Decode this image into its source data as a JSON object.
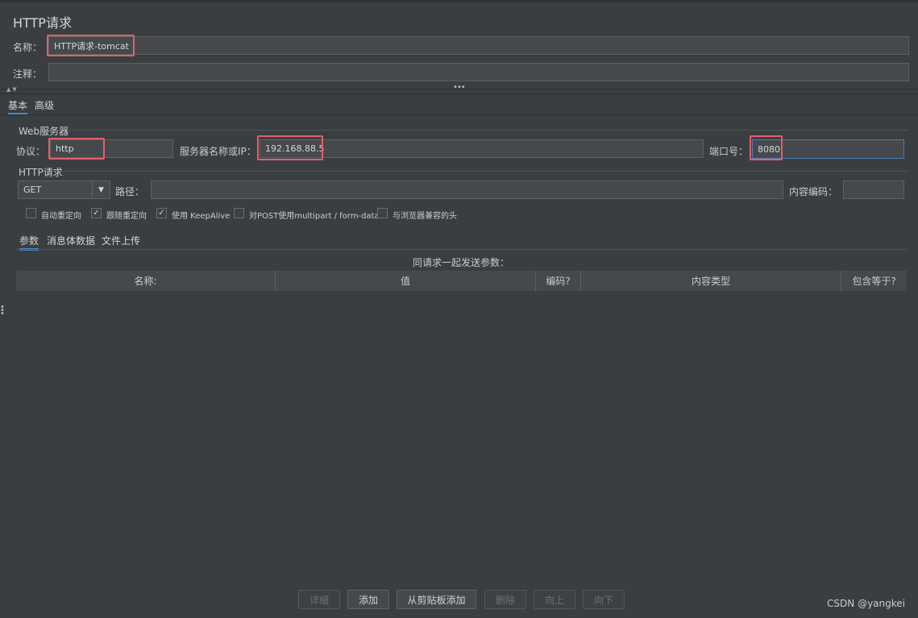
{
  "title": "HTTP请求",
  "name_label": "名称：",
  "name_value": "HTTP请求-tomcat",
  "comment_label": "注释：",
  "comment_value": "",
  "tabs": {
    "basic": "基本",
    "advanced": "高级"
  },
  "web_server": {
    "group_title": "Web服务器",
    "protocol_label": "协议：",
    "protocol_value": "http",
    "server_label": "服务器名称或IP：",
    "server_value": "192.168.88.5",
    "port_label": "端口号：",
    "port_value": "8080"
  },
  "http_request": {
    "group_title": "HTTP请求",
    "method": "GET",
    "path_label": "路径：",
    "path_value": "",
    "encoding_label": "内容编码：",
    "encoding_value": ""
  },
  "checkboxes": [
    {
      "label": "自动重定向",
      "checked": false
    },
    {
      "label": "跟随重定向",
      "checked": true
    },
    {
      "label": "使用 KeepAlive",
      "checked": true
    },
    {
      "label": "对POST使用multipart / form-data",
      "checked": false
    },
    {
      "label": "与浏览器兼容的头",
      "checked": false
    }
  ],
  "subtabs": {
    "params": "参数",
    "body": "消息体数据",
    "files": "文件上传"
  },
  "table": {
    "caption": "同请求一起发送参数：",
    "columns": [
      "名称:",
      "值",
      "编码?",
      "内容类型",
      "包含等于?"
    ]
  },
  "buttons": {
    "detail": "详细",
    "add": "添加",
    "add_clipboard": "从剪贴板添加",
    "delete": "删除",
    "up": "向上",
    "down": "向下"
  },
  "watermark": "CSDN @yangkei",
  "colors": {
    "highlight": "#e0606a",
    "accent": "#4a88c7",
    "background": "#3b3e40"
  }
}
